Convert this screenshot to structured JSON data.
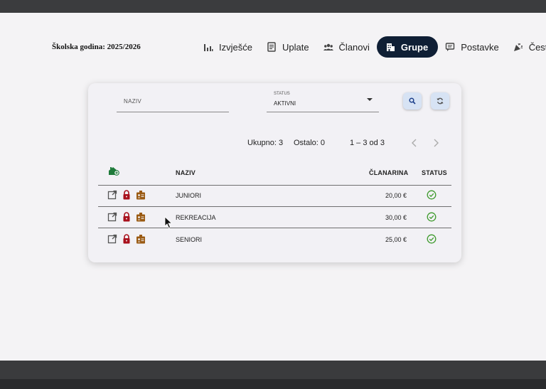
{
  "header": {
    "school_year": "Školska godina: 2025/2026"
  },
  "nav": [
    {
      "label": "Izvješće",
      "icon": "bar-chart-icon",
      "active": false
    },
    {
      "label": "Uplate",
      "icon": "receipt-icon",
      "active": false
    },
    {
      "label": "Članovi",
      "icon": "people-icon",
      "active": false
    },
    {
      "label": "Grupe",
      "icon": "building-icon",
      "active": true
    },
    {
      "label": "Postavke",
      "icon": "message-icon",
      "active": false
    },
    {
      "label": "Čestit",
      "icon": "party-popper-icon",
      "active": false
    }
  ],
  "filters": {
    "naziv_placeholder": "NAZIV",
    "status_label": "STATUS",
    "status_value": "AKTIVNI"
  },
  "summary": {
    "total": "Ukupno: 3",
    "remaining": "Ostalo: 0",
    "range": "1 – 3 od 3"
  },
  "table": {
    "columns": {
      "naziv": "NAZIV",
      "clanarina": "ČLANARINA",
      "status": "STATUS"
    },
    "rows": [
      {
        "naziv": "JUNIORI",
        "clanarina": "20,00 €",
        "active": true
      },
      {
        "naziv": "REKREACIJA",
        "clanarina": "30,00 €",
        "active": true
      },
      {
        "naziv": "SENIORI",
        "clanarina": "25,00 €",
        "active": true
      }
    ]
  },
  "colors": {
    "nav_active_bg": "#0f1f35",
    "icon_button_bg": "#d7e3f4",
    "lock_red": "#a8101c",
    "badge_brown": "#9a5a12",
    "status_green": "#3f9b2e",
    "add_group_green": "#1e7a3a"
  }
}
